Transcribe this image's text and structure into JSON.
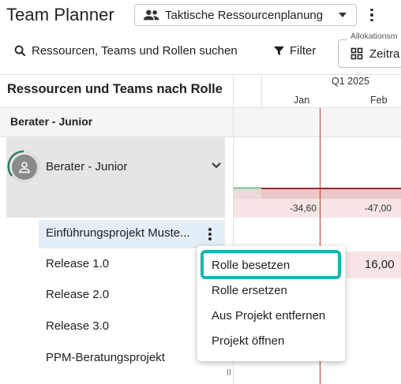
{
  "header": {
    "title": "Team Planner",
    "view_select_label": "Taktische Ressourcenplanung"
  },
  "toolbar": {
    "search_label": "Ressourcen, Teams und Rollen suchen",
    "filter_label": "Filter",
    "allocation_legend": "Allokationsm",
    "allocation_value": "Zeitra"
  },
  "grid": {
    "title": "Ressourcen und Teams nach Rolle",
    "quarter": "Q1 2025",
    "months": [
      "Jan",
      "Feb"
    ]
  },
  "group": {
    "label": "Berater - Junior"
  },
  "role": {
    "label": "Berater - Junior",
    "capacity_values": [
      "-34,60",
      "-47,00"
    ]
  },
  "projects": [
    {
      "label": "Einführungsprojekt Muste..."
    },
    {
      "label": "Release 1.0"
    },
    {
      "label": "Release 2.0"
    },
    {
      "label": "Release 3.0"
    },
    {
      "label": "PPM-Beratungsprojekt"
    }
  ],
  "release1_value": "16,00",
  "context_menu": {
    "items": [
      {
        "label": "Rolle besetzen"
      },
      {
        "label": "Rolle ersetzen"
      },
      {
        "label": "Aus Projekt entfernen"
      },
      {
        "label": "Projekt öffnen"
      }
    ]
  },
  "colors": {
    "highlight": "#18b5ac",
    "today_line": "#c0392b",
    "overallocation": "#f7e4e4",
    "selected_row": "#e3eef8"
  }
}
